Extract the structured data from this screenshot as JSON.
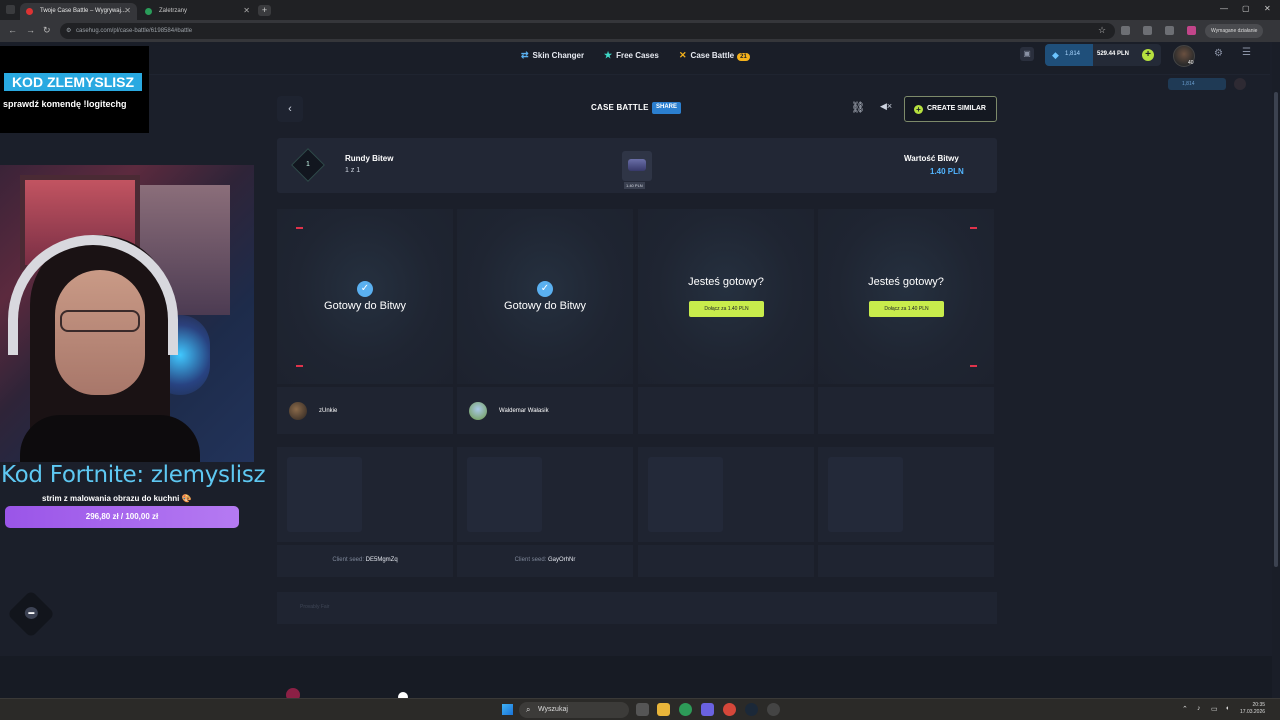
{
  "browser": {
    "tabs": [
      {
        "title": "Twoje Case Battle – Wygrywaj...",
        "active": true
      },
      {
        "title": "Zaletrzany",
        "active": false
      }
    ],
    "url": "casehug.com/pl/case-battle/6198584#battle",
    "profile_label": "Wymagane działanie"
  },
  "header": {
    "nav": [
      {
        "label": "Skin Changer",
        "icon": "swap-icon"
      },
      {
        "label": "Free Cases",
        "icon": "star-icon"
      },
      {
        "label": "Case Battle",
        "icon": "crossed-swords-icon",
        "badge": "21"
      }
    ],
    "points": "1,814",
    "balance": "529.44 PLN",
    "user_level": "40",
    "ghost_points": "1,814"
  },
  "overlay": {
    "promo_code": "KOD ZLEMYSLISZ",
    "promo_sub": "sprawdź komendę !logitechg",
    "fortnite_code": "Kod Fortnite: zlemyslisz",
    "strim_text": "strim z malowania obrazu do kuchni 🎨",
    "goal_text": "296,80 zł / 100,00 zł",
    "goal_progress": 1.0
  },
  "battle": {
    "title": "CASE BATTLE",
    "share_label": "SHARE",
    "create_similar": "CREATE SIMILAR",
    "rounds_label": "Rundy Bitew",
    "rounds_value": "1 z 1",
    "round_number": "1",
    "case_price": "1.40 PLN",
    "value_label": "Wartość Bitwy",
    "value_amount": "1.40 PLN",
    "slots": [
      {
        "state": "ready",
        "text": "Gotowy do Bitwy",
        "player": "zUnkie",
        "seed_label": "Client seed:",
        "seed": "DE5MgmZq"
      },
      {
        "state": "ready",
        "text": "Gotowy do Bitwy",
        "player": "Waldemar Wałasik",
        "seed_label": "Client seed:",
        "seed": "GayOrhNr"
      },
      {
        "state": "waiting",
        "question": "Jesteś gotowy?",
        "button": "Dołącz za 1.40 PLN"
      },
      {
        "state": "waiting",
        "question": "Jesteś gotowy?",
        "button": "Dołącz za 1.40 PLN"
      }
    ],
    "provably_fair": "Provably Fair"
  },
  "taskbar": {
    "search_placeholder": "Wyszukaj",
    "time": "20:35",
    "date": "17.03.2026"
  },
  "colors": {
    "accent_green": "#c8ec4c",
    "accent_blue": "#52b5ff",
    "ready_check": "#5ab0f0",
    "promo_blue": "#29a9e1",
    "goal_purple": "#9a55e8"
  }
}
